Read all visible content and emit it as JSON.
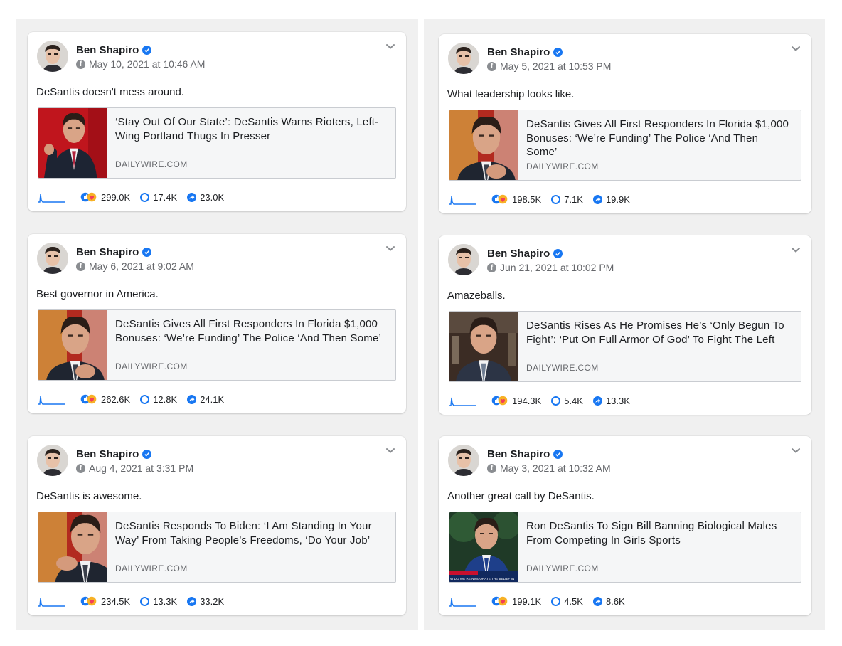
{
  "posts": [
    {
      "author": "Ben Shapiro",
      "date": "May 10, 2021 at 10:46 AM",
      "message": "DeSantis doesn't mess around.",
      "headline": "‘Stay Out Of Our State’: DeSantis Warns Rioters, Left-Wing Portland Thugs In Presser",
      "domain": "DAILYWIRE.COM",
      "reactions": "299.0K",
      "comments": "17.4K",
      "shares": "23.0K"
    },
    {
      "author": "Ben Shapiro",
      "date": "May 6, 2021 at 9:02 AM",
      "message": "Best governor in America.",
      "headline": "DeSantis Gives All First Responders In Florida $1,000 Bonuses: ‘We’re Funding’ The Police ‘And Then Some’",
      "domain": "DAILYWIRE.COM",
      "reactions": "262.6K",
      "comments": "12.8K",
      "shares": "24.1K"
    },
    {
      "author": "Ben Shapiro",
      "date": "Aug 4, 2021 at 3:31 PM",
      "message": "DeSantis is awesome.",
      "headline": "DeSantis Responds To Biden: ‘I Am Standing In Your Way’ From Taking People’s Freedoms, ‘Do Your Job’",
      "domain": "DAILYWIRE.COM",
      "reactions": "234.5K",
      "comments": "13.3K",
      "shares": "33.2K"
    },
    {
      "author": "Ben Shapiro",
      "date": "May 5, 2021 at 10:53 PM",
      "message": "What leadership looks like.",
      "headline": "DeSantis Gives All First Responders In Florida $1,000 Bonuses: ‘We’re Funding’ The Police ‘And Then Some’",
      "domain": "DAILYWIRE.COM",
      "reactions": "198.5K",
      "comments": "7.1K",
      "shares": "19.9K"
    },
    {
      "author": "Ben Shapiro",
      "date": "Jun 21, 2021 at 10:02 PM",
      "message": "Amazeballs.",
      "headline": "DeSantis Rises As He Promises He’s ‘Only Begun To Fight’: ‘Put On Full Armor Of God’ To Fight The Left",
      "domain": "DAILYWIRE.COM",
      "reactions": "194.3K",
      "comments": "5.4K",
      "shares": "13.3K"
    },
    {
      "author": "Ben Shapiro",
      "date": "May 3, 2021 at 10:32 AM",
      "message": "Another great call by DeSantis.",
      "headline": "Ron DeSantis To Sign Bill Banning Biological Males From Competing In Girls Sports",
      "domain": "DAILYWIRE.COM",
      "reactions": "199.1K",
      "comments": "4.5K",
      "shares": "8.6K",
      "thumb_caption": "W DO WE REINVIGORATE THE BELIEF IN"
    }
  ],
  "icons": {
    "verified": "verified-badge-icon",
    "platform": "facebook-icon",
    "menu": "chevron-down-icon",
    "reactions": "reactions-icon",
    "comments": "comment-icon",
    "shares": "share-icon"
  },
  "colors": {
    "verified_blue": "#1877f2",
    "reaction_red": "#f33e58",
    "reaction_orange": "#f7b125",
    "muted_text": "#65676b"
  }
}
